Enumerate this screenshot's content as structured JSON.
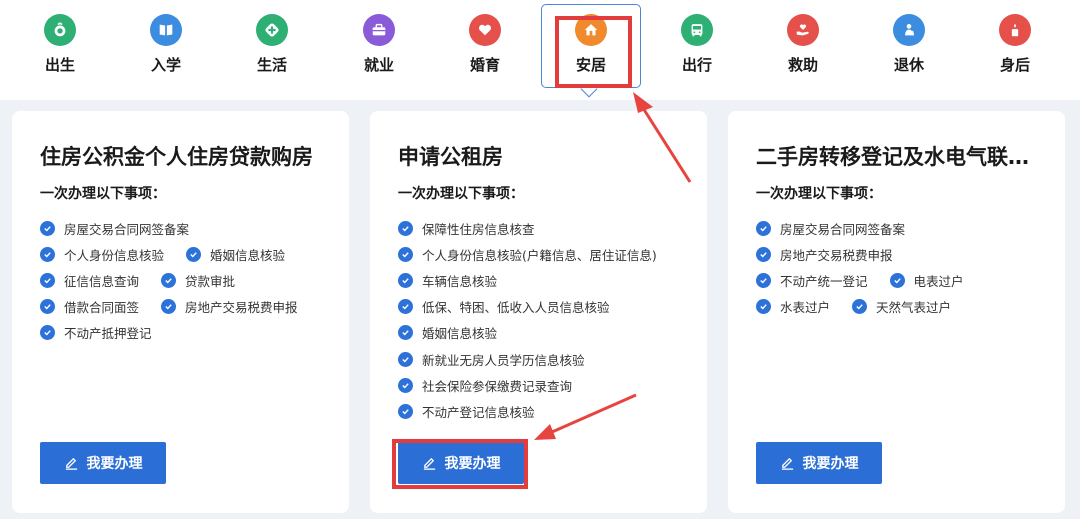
{
  "categories": [
    {
      "label": "出生",
      "icon": "baby-icon",
      "color": "#2eaf74"
    },
    {
      "label": "入学",
      "icon": "book-icon",
      "color": "#3c8de0"
    },
    {
      "label": "生活",
      "icon": "life-plus-icon",
      "color": "#2eaf74"
    },
    {
      "label": "就业",
      "icon": "briefcase-icon",
      "color": "#8a5ad8"
    },
    {
      "label": "婚育",
      "icon": "heart-icon",
      "color": "#e6504a"
    },
    {
      "label": "安居",
      "icon": "house-icon",
      "color": "#f08a2c"
    },
    {
      "label": "出行",
      "icon": "bus-icon",
      "color": "#2eaf74"
    },
    {
      "label": "救助",
      "icon": "help-hand-icon",
      "color": "#e6504a"
    },
    {
      "label": "退休",
      "icon": "retiree-icon",
      "color": "#3c8de0"
    },
    {
      "label": "身后",
      "icon": "candle-icon",
      "color": "#e6504a"
    }
  ],
  "active_category": "安居",
  "cards": [
    {
      "title": "住房公积金个人住房贷款购房",
      "subtitle": "一次办理以下事项：",
      "rows": [
        [
          "房屋交易合同网签备案"
        ],
        [
          "个人身份信息核验",
          "婚姻信息核验"
        ],
        [
          "征信信息查询",
          "贷款审批"
        ],
        [
          "借款合同面签",
          "房地产交易税费申报"
        ],
        [
          "不动产抵押登记"
        ]
      ],
      "button": "我要办理"
    },
    {
      "title": "申请公租房",
      "subtitle": "一次办理以下事项：",
      "rows": [
        [
          "保障性住房信息核查"
        ],
        [
          "个人身份信息核验(户籍信息、居住证信息)"
        ],
        [
          "车辆信息核验"
        ],
        [
          "低保、特困、低收入人员信息核验"
        ],
        [
          "婚姻信息核验"
        ],
        [
          "新就业无房人员学历信息核验"
        ],
        [
          "社会保险参保缴费记录查询"
        ],
        [
          "不动产登记信息核验"
        ]
      ],
      "button": "我要办理"
    },
    {
      "title": "二手房转移登记及水电气联…",
      "subtitle": "一次办理以下事项：",
      "rows": [
        [
          "房屋交易合同网签备案"
        ],
        [
          "房地产交易税费申报"
        ],
        [
          "不动产统一登记",
          "电表过户"
        ],
        [
          "水表过户",
          "天然气表过户"
        ]
      ],
      "button": "我要办理"
    }
  ],
  "colors": {
    "accent": "#2b6fd6",
    "highlight_red": "#e23c3c",
    "active_border": "#4a86d8"
  }
}
